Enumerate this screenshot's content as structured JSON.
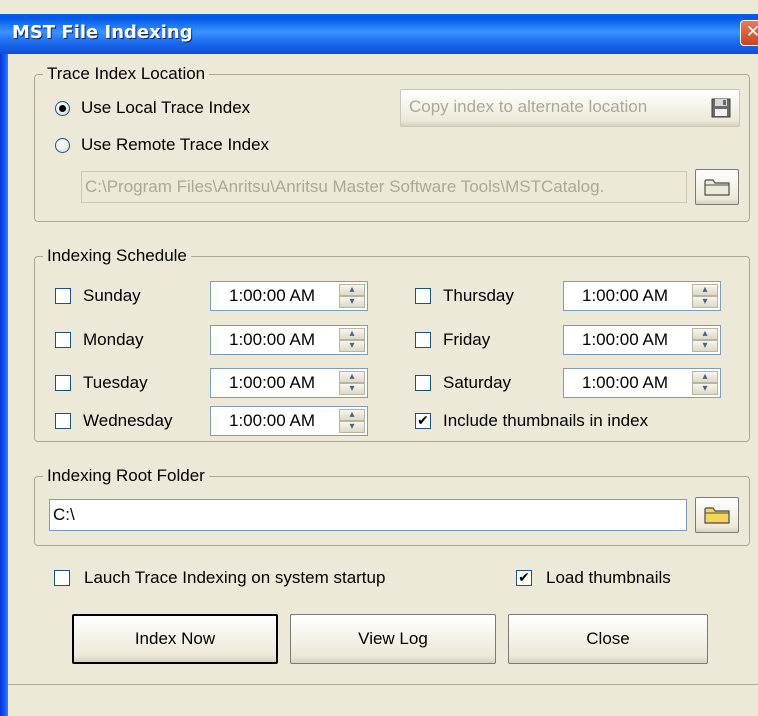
{
  "window": {
    "title": "MST File Indexing",
    "close_glyph": "✕"
  },
  "trace_index_location": {
    "legend": "Trace Index Location",
    "local_label": "Use Local Trace Index",
    "remote_label": "Use Remote Trace Index",
    "selected": "local",
    "copy_button_label": "Copy index to alternate location",
    "path_value": "C:\\Program Files\\Anritsu\\Anritsu Master Software Tools\\MSTCatalog."
  },
  "indexing_schedule": {
    "legend": "Indexing Schedule",
    "days": [
      {
        "label": "Sunday",
        "checked": false,
        "time": "1:00:00 AM"
      },
      {
        "label": "Monday",
        "checked": false,
        "time": "1:00:00 AM"
      },
      {
        "label": "Tuesday",
        "checked": false,
        "time": "1:00:00 AM"
      },
      {
        "label": "Wednesday",
        "checked": false,
        "time": "1:00:00 AM"
      },
      {
        "label": "Thursday",
        "checked": false,
        "time": "1:00:00 AM"
      },
      {
        "label": "Friday",
        "checked": false,
        "time": "1:00:00 AM"
      },
      {
        "label": "Saturday",
        "checked": false,
        "time": "1:00:00 AM"
      }
    ],
    "include_thumbnails_label": "Include thumbnails in index",
    "include_thumbnails_checked": true
  },
  "root_folder": {
    "legend": "Indexing Root Folder",
    "value": "C:\\"
  },
  "options": {
    "launch_on_startup_label": "Lauch Trace Indexing on system startup",
    "launch_on_startup_checked": false,
    "load_thumbnails_label": "Load thumbnails",
    "load_thumbnails_checked": true
  },
  "buttons": {
    "index_now": "Index Now",
    "view_log": "View Log",
    "close": "Close"
  },
  "icons": {
    "save": "floppy-disk-icon",
    "folder": "folder-icon",
    "check_mark": "✔"
  },
  "colors": {
    "titlebar": "#0a5ee8",
    "dialog_bg": "#ece9d8",
    "folder_yellow": "#f5d45a"
  }
}
